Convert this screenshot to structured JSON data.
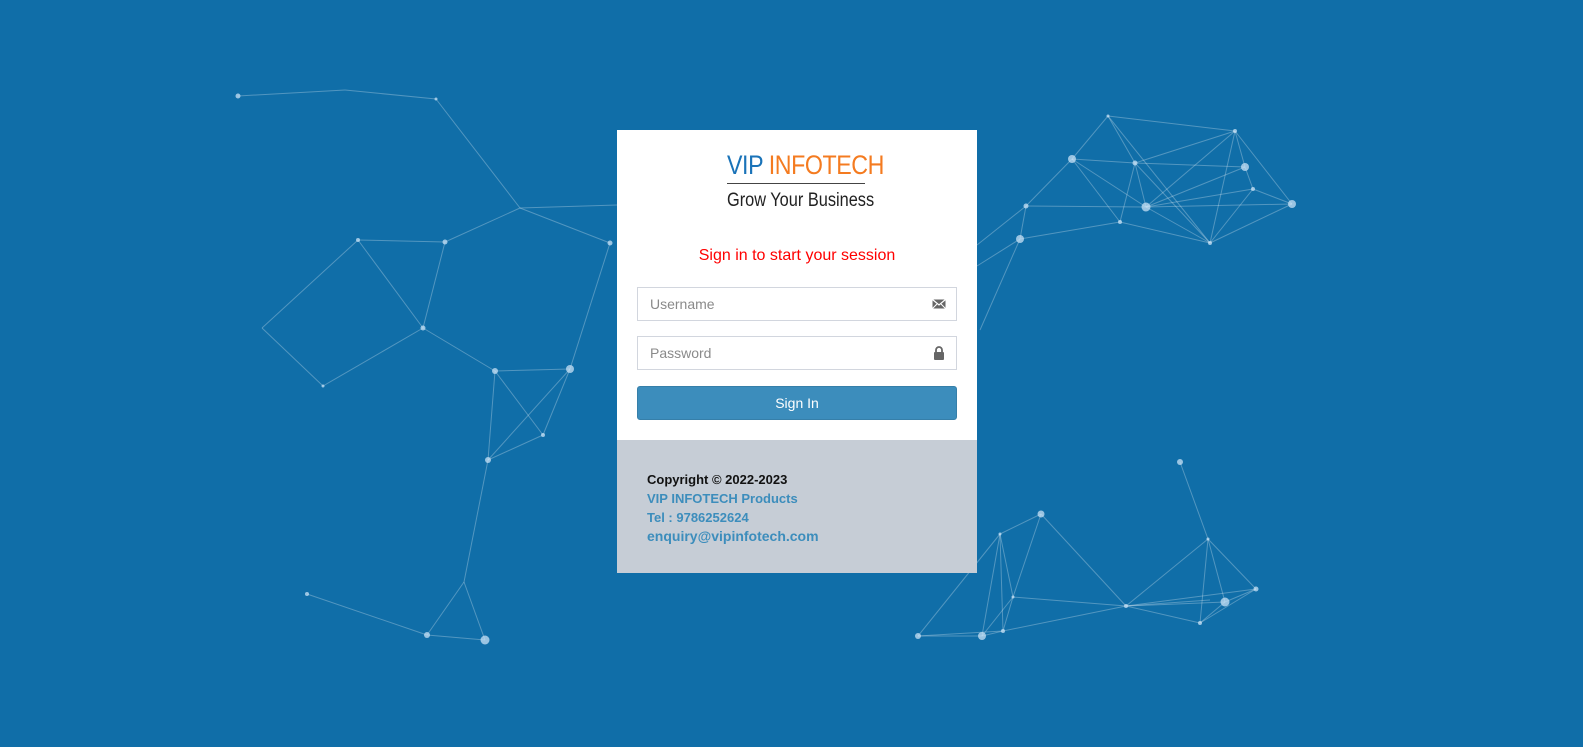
{
  "brand": {
    "name_part1": "VIP",
    "name_part2": "INFOTECH",
    "tagline": "Grow Your Business"
  },
  "login": {
    "message": "Sign in to start your session",
    "username_placeholder": "Username",
    "password_placeholder": "Password",
    "username_icon": "envelope-icon",
    "password_icon": "lock-icon",
    "signin_label": "Sign In"
  },
  "footer": {
    "copyright": "Copyright © 2022-2023",
    "products_link": "VIP INFOTECH Products",
    "tel": "Tel : 9786252624",
    "email": "enquiry@vipinfotech.com"
  },
  "colors": {
    "background": "#106ea8",
    "message": "#ff0000",
    "button": "#3c8dbc",
    "footer_bg": "#c6cdd6",
    "logo_blue": "#1a73b8",
    "logo_orange": "#f47b20"
  }
}
